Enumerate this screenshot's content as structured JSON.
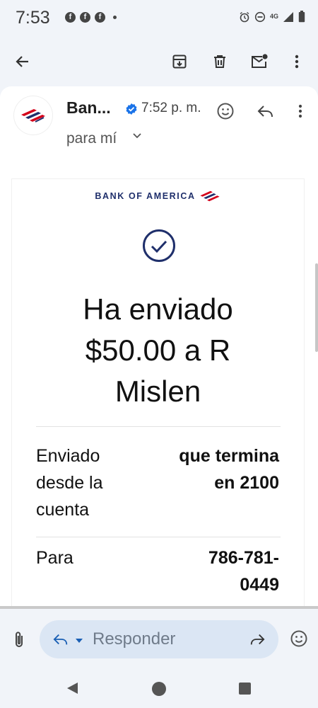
{
  "status_bar": {
    "time": "7:53",
    "notification_icons": [
      "facebook-icon",
      "facebook-icon",
      "facebook-icon",
      "more-notifications-dot"
    ],
    "system_icons": [
      "alarm-icon",
      "do-not-disturb-icon",
      "4g-lte-icon",
      "signal-icon",
      "battery-icon"
    ],
    "network_label": "4G"
  },
  "toolbar": {
    "actions": [
      "back-arrow-icon",
      "archive-icon",
      "delete-icon",
      "mark-unread-icon",
      "more-vertical-icon"
    ]
  },
  "email_header": {
    "sender": "Ban...",
    "verified": true,
    "time": "7:52 p. m.",
    "recipient": "para mí"
  },
  "email_body": {
    "brand": "BANK OF AMERICA",
    "headline_lines": [
      "Ha enviado",
      "$50.00 a R",
      "Mislen"
    ],
    "rows": [
      {
        "label_lines": [
          "Enviado",
          "desde la",
          "cuenta"
        ],
        "value_lines": [
          "que termina",
          "en 2100"
        ]
      },
      {
        "label_lines": [
          "Para"
        ],
        "value_lines": [
          "786-781-",
          "0449"
        ]
      }
    ]
  },
  "reply_bar": {
    "placeholder": "Responder"
  },
  "colors": {
    "brand_navy": "#1f2f6b",
    "brand_red": "#d4001a",
    "verified_blue": "#1a73e8",
    "reply_pill": "#dbe6f4",
    "background": "#f1f4f9"
  }
}
